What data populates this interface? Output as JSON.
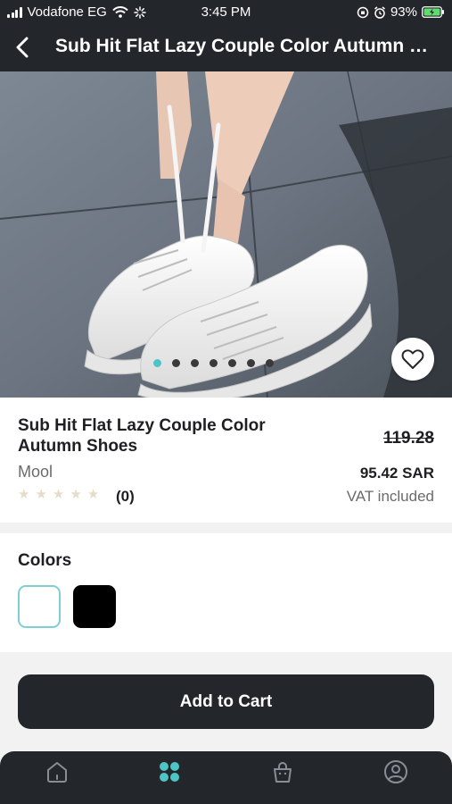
{
  "status_bar": {
    "carrier": "Vodafone EG",
    "time": "3:45 PM",
    "battery": "93%"
  },
  "header": {
    "title": "Sub Hit Flat Lazy Couple Color Autumn Shoes"
  },
  "gallery": {
    "image_description_icon": "sneaker-product-photo",
    "dot_count": 7,
    "active_dot": 0
  },
  "product": {
    "name": "Sub Hit Flat Lazy Couple Color Autumn Shoes",
    "brand": "Mool",
    "review_count": "(0)",
    "rating": 0,
    "old_price": "119.28",
    "price": "95.42 SAR",
    "vat": "VAT included"
  },
  "colors": {
    "heading": "Colors",
    "options": [
      {
        "name": "white",
        "hex": "#ffffff",
        "selected": true
      },
      {
        "name": "black",
        "hex": "#000000",
        "selected": false
      }
    ]
  },
  "actions": {
    "add_to_cart": "Add to Cart"
  },
  "tabs": [
    {
      "icon": "home-icon",
      "active": false
    },
    {
      "icon": "grid-icon",
      "active": true
    },
    {
      "icon": "shopping-bag-icon",
      "active": false
    },
    {
      "icon": "profile-icon",
      "active": false
    }
  ],
  "theme": {
    "dark": "#23262b",
    "accent": "#4fc4c6"
  }
}
